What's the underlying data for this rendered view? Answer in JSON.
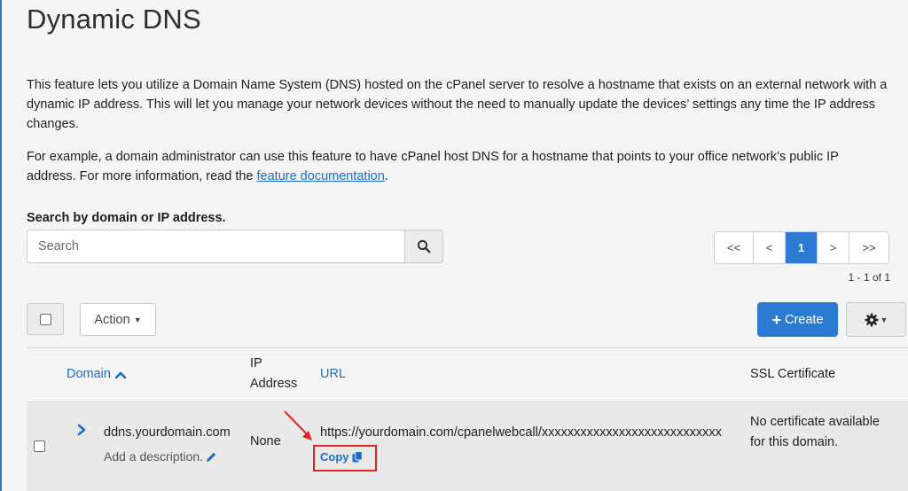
{
  "page": {
    "title": "Dynamic DNS",
    "intro": "This feature lets you utilize a Domain Name System (DNS) hosted on the cPanel server to resolve a hostname that exists on an external network with a dynamic IP address. This will let you manage your network devices without the need to manually update the devices’ settings any time the IP address changes.",
    "example_text": "For example, a domain administrator can use this feature to have cPanel host DNS for a hostname that points to your office network’s public IP address. For more information, read the ",
    "doc_link_text": "feature documentation",
    "example_end": "."
  },
  "search": {
    "label": "Search by domain or IP address.",
    "placeholder": "Search",
    "value": "",
    "icon": "search-icon"
  },
  "pagination": {
    "first": "<<",
    "prev": "<",
    "current": "1",
    "next": ">",
    "last": ">>",
    "count": "1 - 1 of 1"
  },
  "toolbar": {
    "action_label": "Action",
    "create_label": "Create",
    "settings_icon": "gear-icon"
  },
  "table": {
    "headers": {
      "domain": "Domain",
      "ip_line1": "IP",
      "ip_line2": "Address",
      "url": "URL",
      "ssl": "SSL Certificate"
    },
    "rows": [
      {
        "domain": "ddns.yourdomain.com",
        "description": "Add a description.",
        "ip": "None",
        "url": "https://yourdomain.com/cpanelwebcall/xxxxxxxxxxxxxxxxxxxxxxxxxxxx",
        "copy_label": "Copy",
        "ssl": "No certificate available for this domain."
      }
    ]
  },
  "colors": {
    "accent": "#2a7bd1",
    "link": "#1a6dc2",
    "highlight": "#e02424"
  }
}
